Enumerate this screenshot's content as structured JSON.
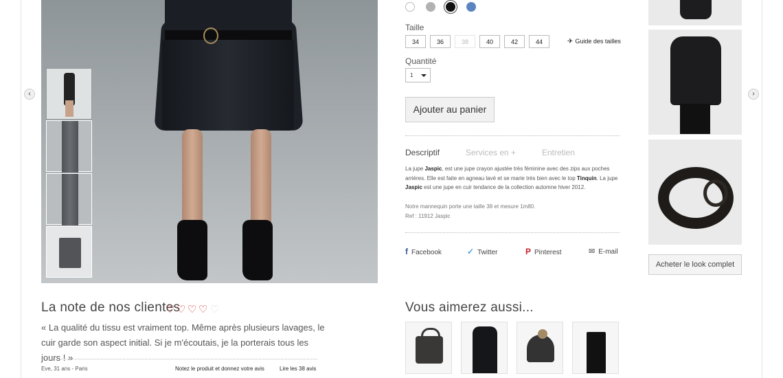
{
  "colors": {
    "swatches": [
      "#ffffff",
      "#b2b2b2",
      "#111111",
      "#5b85c0"
    ],
    "accent_heart": "#d11e28"
  },
  "size": {
    "label": "Taille",
    "options": [
      "34",
      "36",
      "38",
      "40",
      "42",
      "44"
    ],
    "disabled": [
      "38"
    ],
    "guide_label": "Guide des tailles"
  },
  "quantity": {
    "label": "Quantité",
    "value": "1"
  },
  "cart_button": "Ajouter au panier",
  "tabs": [
    "Descriptif",
    "Services en +",
    "Entretien"
  ],
  "description": {
    "p1": "La jupe Jaspic, est une jupe crayon ajustée très féminine avec des zips aux poches arrières. Elle est faite en agneau lavé et se marie très bien avec le top Tinquin. La jupe Jaspic est une jupe en cuir tendance de la collection automne hiver 2012.",
    "model_note": "Notre mannequin porte une taille 38 et mesure 1m80.",
    "ref": "Ref : 11912 Jaspic"
  },
  "share": [
    "Facebook",
    "Twitter",
    "Pinterest",
    "E-mail"
  ],
  "look_button": "Acheter le look complet",
  "reviews": {
    "title": "La note de nos clientes",
    "rating": 4,
    "max": 5,
    "quote": "« La qualité du tissu est vraiment top. Même après plusieurs lavages, le cuir garde son aspect initial. Si je m'écoutais, je la porterais tous les jours ! »",
    "author": "Eve, 31 ans - Paris",
    "write_link": "Notez le produit et donnez votre avis",
    "read_link": "Lire les 38 avis"
  },
  "recommend": {
    "title": "Vous aimerez aussi..."
  },
  "icons": {
    "prev": "chevron-left-icon",
    "next": "chevron-right-icon",
    "guide": "shoe-icon",
    "facebook": "facebook-icon",
    "twitter": "twitter-icon",
    "pinterest": "pinterest-icon",
    "email": "envelope-icon",
    "heart": "heart-icon"
  }
}
